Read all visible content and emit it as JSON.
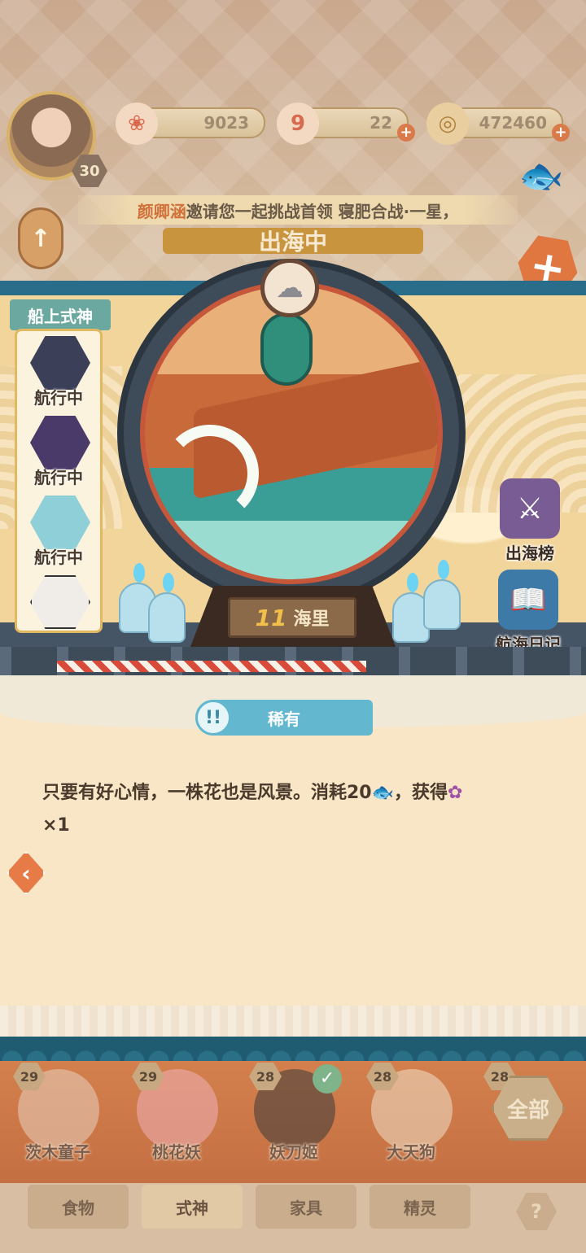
{
  "player": {
    "level": "30"
  },
  "resources": [
    {
      "name": "plum-blossom",
      "value": "9023",
      "icon": "❀",
      "color": "#d86a50"
    },
    {
      "name": "nine-token",
      "value": "22",
      "icon": "9",
      "color": "#d86a50"
    },
    {
      "name": "coin",
      "value": "472460",
      "icon": "◎",
      "color": "#c9944a"
    }
  ],
  "invite": {
    "name": "颜卿涵",
    "message": "邀请您一起挑战首领 寝肥合战·一星，"
  },
  "status": {
    "label": "出海中"
  },
  "crew": {
    "title": "船上式神",
    "members": [
      {
        "status": "航行中",
        "color": "#3c3f58"
      },
      {
        "status": "航行中",
        "color": "#4a3a6a"
      },
      {
        "status": "航行中",
        "color": "#8fd0d8"
      },
      {
        "status": "",
        "color": "#f0ece8"
      }
    ]
  },
  "voyage": {
    "distance": "11",
    "unit": "海里"
  },
  "side_buttons": {
    "ranking": "出海榜",
    "journal": "航海日记"
  },
  "event": {
    "rarity": "稀有",
    "text_before": "只要有好心情，一株花也是风景。消耗20",
    "text_middle": "，获得",
    "reward_count": "×1"
  },
  "shikigami": [
    {
      "level": "29",
      "name": "茨木童子",
      "color": "#e8d0c0"
    },
    {
      "level": "29",
      "name": "桃花妖",
      "color": "#f0b0b8"
    },
    {
      "level": "28",
      "name": "妖刀姬",
      "color": "#3a3a3a"
    },
    {
      "level": "28",
      "name": "大天狗",
      "color": "#f0e0c8"
    },
    {
      "level": "28",
      "name": "",
      "color": "#c8a0a0"
    }
  ],
  "all_button": "全部",
  "tabs": [
    "食物",
    "式神",
    "家具",
    "精灵"
  ],
  "help": "?"
}
